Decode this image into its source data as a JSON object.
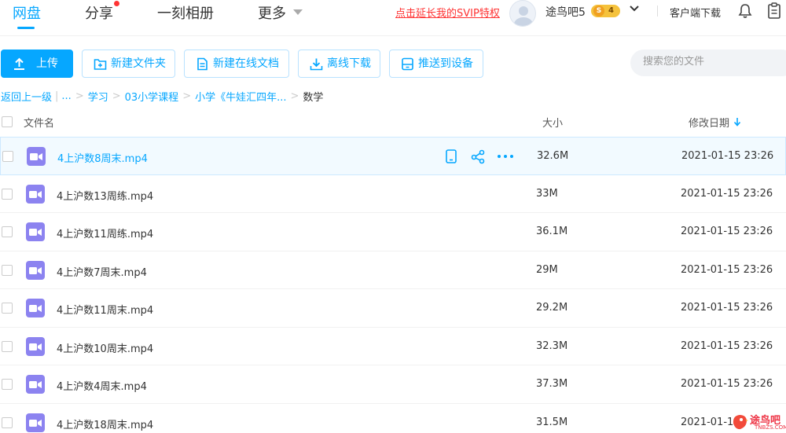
{
  "nav": {
    "tabs": [
      {
        "label": "网盘",
        "active": true
      },
      {
        "label": "分享",
        "active": false
      },
      {
        "label": "一刻相册",
        "active": false
      },
      {
        "label": "更多",
        "active": false
      }
    ],
    "svip_link": "点击延长我的SVIP特权",
    "username": "途鸟吧5",
    "vip_s": "S",
    "vip_level": "4",
    "client_download": "客户端下载"
  },
  "toolbar": {
    "upload": "上传",
    "new_folder": "新建文件夹",
    "new_online_doc": "新建在线文档",
    "offline_download": "离线下载",
    "push_to_device": "推送到设备",
    "search_placeholder": "搜索您的文件"
  },
  "breadcrumb": {
    "back": "返回上一级",
    "ellipsis": "...",
    "items": [
      "学习",
      "03小学课程",
      "小学《牛娃汇四年..."
    ],
    "current": "数学"
  },
  "table": {
    "col_name": "文件名",
    "col_size": "大小",
    "col_date": "修改日期",
    "rows": [
      {
        "name": "4上沪数8周末.mp4",
        "size": "32.6M",
        "date": "2021-01-15 23:26"
      },
      {
        "name": "4上沪数13周练.mp4",
        "size": "33M",
        "date": "2021-01-15 23:26"
      },
      {
        "name": "4上沪数11周练.mp4",
        "size": "36.1M",
        "date": "2021-01-15 23:26"
      },
      {
        "name": "4上沪数7周末.mp4",
        "size": "29M",
        "date": "2021-01-15 23:26"
      },
      {
        "name": "4上沪数11周末.mp4",
        "size": "29.2M",
        "date": "2021-01-15 23:26"
      },
      {
        "name": "4上沪数10周末.mp4",
        "size": "32.3M",
        "date": "2021-01-15 23:26"
      },
      {
        "name": "4上沪数4周末.mp4",
        "size": "37.3M",
        "date": "2021-01-15 23:26"
      },
      {
        "name": "4上沪数18周末.mp4",
        "size": "31.5M",
        "date": "2021-01-1"
      }
    ]
  },
  "watermark": {
    "text": "途鸟吧",
    "sub": "TNBZS.COM"
  },
  "colors": {
    "accent": "#06a7ff",
    "video_icon": "#8c83f0",
    "svip_red": "#f33"
  }
}
